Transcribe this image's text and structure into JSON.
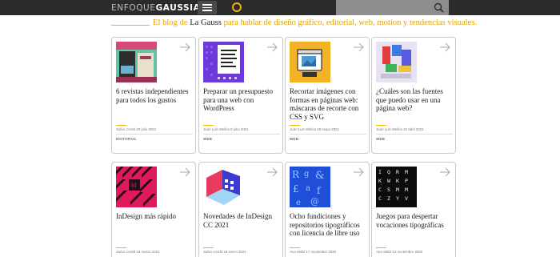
{
  "header": {
    "logo_light": "ENFOQUE",
    "logo_bold": "GAUSSIANO"
  },
  "tagline": {
    "before": "El blog de ",
    "brand": "La Gauss",
    "after": " para hablar de diseño gráfico, editorial, web, motion y tendencias visuales."
  },
  "icons": {
    "menu": "hamburger-menu-icon",
    "theme": "sun-icon",
    "search": "search-icon",
    "arrow": "arrow-right-icon"
  },
  "colors": {
    "accent": "#f0b400",
    "topbar": "#2b2b2b",
    "search_bg": "#8d8d8d"
  },
  "cards": [
    {
      "title": "6 revistas independientes para todos los gustos",
      "author": "Salva Cerdá",
      "date": "20 julio 2021",
      "category": "EDITORIAL"
    },
    {
      "title": "Preparar un presupuesto para una web con WordPress",
      "author": "Juan Luis Molina",
      "date": "8 julio 2021",
      "category": "WEB"
    },
    {
      "title": "Recortar imágenes con formas en páginas web: máscaras de recorte con CSS y SVG",
      "author": "Juan Luis Molina",
      "date": "19 mayo 2021",
      "category": "WEB"
    },
    {
      "title": "¿Cuáles son las fuentes que puedo usar en una página web?",
      "author": "Juan Luis Molina",
      "date": "21 abril 2021",
      "category": "WEB"
    },
    {
      "title": "InDesign más rápido",
      "author": "Salva Cerdá",
      "date": "18 marzo 2021",
      "category": ""
    },
    {
      "title": "Novedades de InDesign CC 2021",
      "author": "Salva Cerdá",
      "date": "18 enero 2021",
      "category": ""
    },
    {
      "title": "Ocho fundiciones y repositorios tipográficos con licencia de libre uso",
      "author": "Ana Moliz",
      "date": "17 noviembre 2020",
      "category": ""
    },
    {
      "title": "Juegos para despertar vocaciones tipográficas",
      "author": "Ana Moliz",
      "date": "12 noviembre 2020",
      "category": ""
    }
  ]
}
